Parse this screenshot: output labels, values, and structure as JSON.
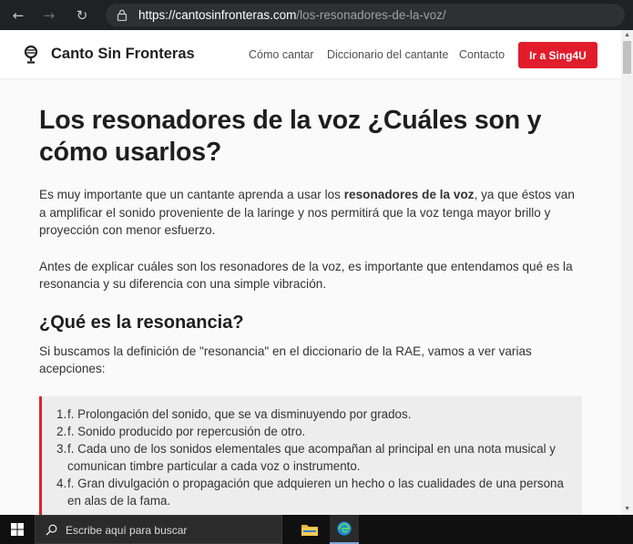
{
  "browser": {
    "url_domain": "https://cantosinfronteras.com",
    "url_path": "/los-resonadores-de-la-voz/"
  },
  "site": {
    "brand": "Canto Sin Fronteras",
    "nav": [
      "Cómo cantar",
      "Diccionario del cantante",
      "Contacto"
    ],
    "cta": "Ir a Sing4U"
  },
  "article": {
    "title": "Los resonadores de la voz ¿Cuáles son y cómo usarlos?",
    "p1_before": "Es muy importante que un cantante aprenda a usar los ",
    "p1_bold": "resonadores de la voz",
    "p1_after": ", ya que éstos van a amplificar el sonido proveniente de la laringe y nos permitirá que la voz tenga mayor brillo y proyección con menor esfuerzo.",
    "p2": "Antes de explicar cuáles son los resonadores de la voz, es importante que entendamos qué es la resonancia y su diferencia con una simple vibración.",
    "h2": "¿Qué es la resonancia?",
    "p3": "Si buscamos la definición de \"resonancia\" en el diccionario de la RAE, vamos a ver varias acepciones:",
    "definitions": [
      {
        "num": "1.",
        "text": "f. Prolongación del sonido, que se va disminuyendo por grados."
      },
      {
        "num": "2.",
        "text": "f. Sonido producido por repercusión de otro."
      },
      {
        "num": "3.",
        "text": "f. Cada uno de los sonidos elementales que acompañan al principal en una nota musical y comunican timbre particular a cada voz o instrumento."
      },
      {
        "num": "4.",
        "text": "f. Gran divulgación o propagación que adquieren un hecho o las cualidades de una persona en alas de la fama."
      }
    ]
  },
  "taskbar": {
    "search_placeholder": "Escribe aquí para buscar"
  }
}
